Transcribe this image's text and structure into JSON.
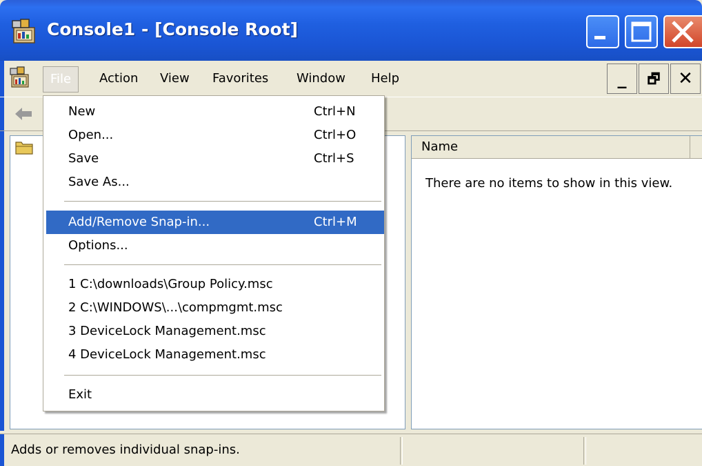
{
  "window": {
    "title": "Console1 - [Console Root]"
  },
  "menubar": {
    "items": [
      "File",
      "Action",
      "View",
      "Favorites",
      "Window",
      "Help"
    ]
  },
  "mdi_controls": {
    "minimize": "_",
    "restore": "🗗",
    "close": "✕"
  },
  "file_menu": {
    "items": [
      {
        "label": "New",
        "shortcut": "Ctrl+N"
      },
      {
        "label": "Open...",
        "shortcut": "Ctrl+O"
      },
      {
        "label": "Save",
        "shortcut": "Ctrl+S"
      },
      {
        "label": "Save As...",
        "shortcut": ""
      },
      {
        "label": "Add/Remove Snap-in...",
        "shortcut": "Ctrl+M",
        "highlighted": true
      },
      {
        "label": "Options...",
        "shortcut": ""
      },
      {
        "label": "1 C:\\downloads\\Group Policy.msc",
        "shortcut": ""
      },
      {
        "label": "2 C:\\WINDOWS\\...\\compmgmt.msc",
        "shortcut": ""
      },
      {
        "label": "3 DeviceLock Management.msc",
        "shortcut": ""
      },
      {
        "label": "4 DeviceLock Management.msc",
        "shortcut": ""
      },
      {
        "label": "Exit",
        "shortcut": ""
      }
    ]
  },
  "right_pane": {
    "column_header": "Name",
    "empty_message": "There are no items to show in this view."
  },
  "statusbar": {
    "text": "Adds or removes individual snap-ins."
  },
  "colors": {
    "titlebar": "#1a55d4",
    "menu_highlight": "#316ac5",
    "window_bg": "#ece9d8"
  },
  "icons": {
    "title": "mmc-console-icon",
    "app": "mmc-console-icon",
    "back": "back-arrow-icon",
    "folder": "folder-icon"
  }
}
